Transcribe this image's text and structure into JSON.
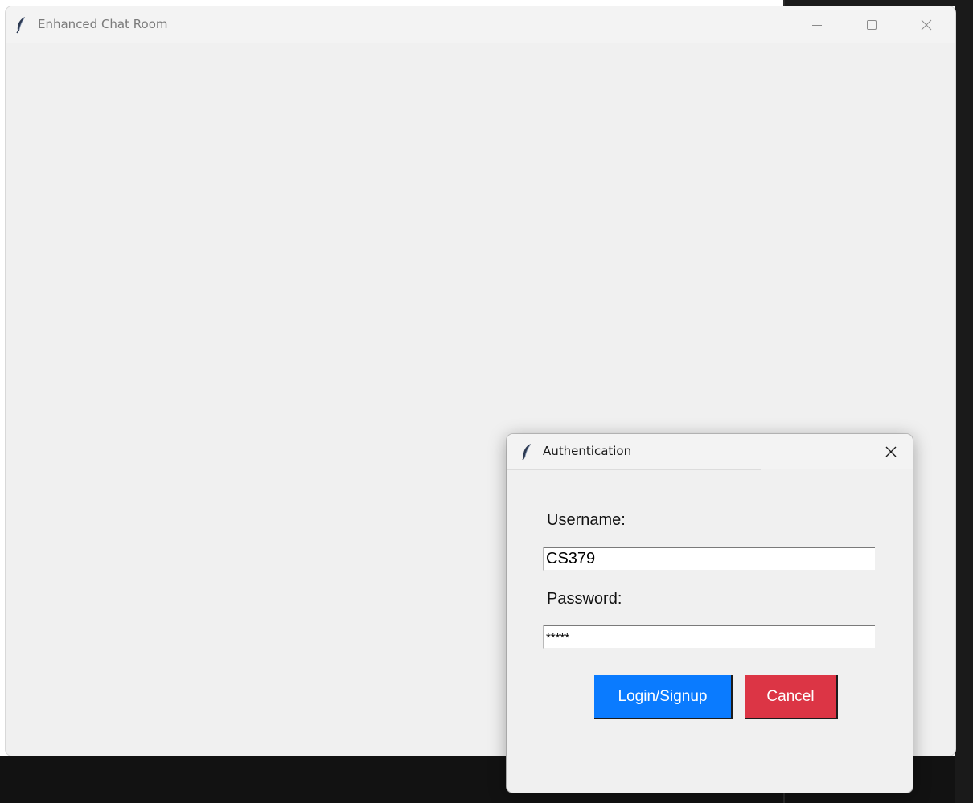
{
  "main_window": {
    "title": "Enhanced Chat Room",
    "icon": "feather-icon",
    "controls": [
      "minimize-icon",
      "maximize-icon",
      "close-icon"
    ]
  },
  "dialog": {
    "title": "Authentication",
    "icon": "feather-icon",
    "username_label": "Username:",
    "username_value": "CS379",
    "password_label": "Password:",
    "password_value": "*****",
    "login_button": "Login/Signup",
    "cancel_button": "Cancel"
  },
  "colors": {
    "login_button": "#0a7bff",
    "cancel_button": "#dc3545",
    "window_background": "#f0f0f0"
  }
}
